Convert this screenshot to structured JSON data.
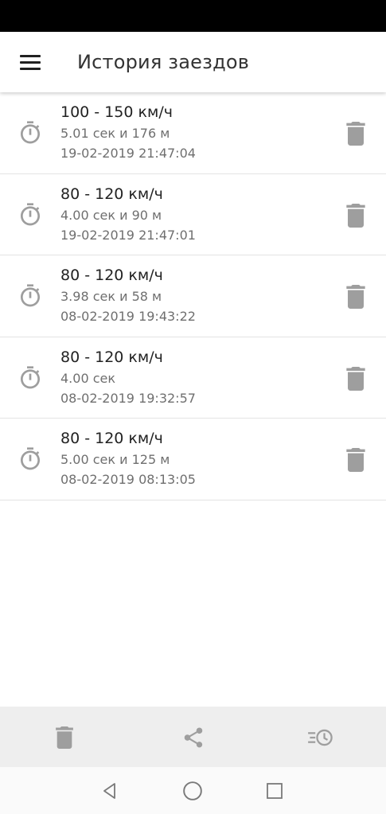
{
  "app_bar": {
    "title": "История заездов",
    "menu_icon": "hamburger-menu-icon"
  },
  "runs": [
    {
      "title": "100 - 150 км/ч",
      "result": "5.01 сек и 176 м",
      "datetime": "19-02-2019 21:47:04"
    },
    {
      "title": "80 - 120 км/ч",
      "result": "4.00 сек и 90 м",
      "datetime": "19-02-2019 21:47:01"
    },
    {
      "title": "80 - 120 км/ч",
      "result": "3.98 сек и 58 м",
      "datetime": "08-02-2019 19:43:22"
    },
    {
      "title": "80 - 120 км/ч",
      "result": "4.00 сек",
      "datetime": "08-02-2019 19:32:57"
    },
    {
      "title": "80 - 120 км/ч",
      "result": "5.00 сек и 125 м",
      "datetime": "08-02-2019 08:13:05"
    }
  ],
  "row_icons": {
    "leading": "stopwatch-icon",
    "trailing": "trash-icon"
  },
  "bottom_bar": {
    "icons": [
      "trash-icon",
      "share-icon",
      "history-icon"
    ]
  },
  "system_nav": {
    "icons": [
      "back-triangle-icon",
      "home-circle-icon",
      "recents-square-icon"
    ]
  },
  "colors": {
    "icon_gray": "#9e9e9e",
    "title_text": "#222222",
    "secondary_text": "#6f6f6f",
    "bottom_bar_bg": "#eeeeee",
    "status_bar": "#000000"
  }
}
